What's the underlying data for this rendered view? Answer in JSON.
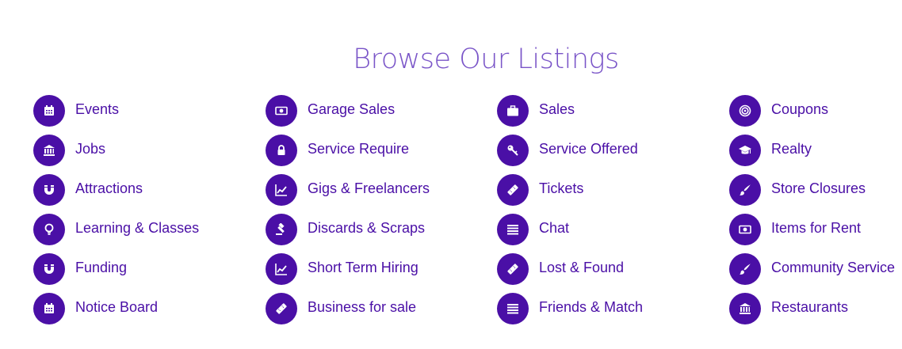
{
  "page": {
    "title": "Browse Our Listings"
  },
  "colors": {
    "title": "#7a55c8",
    "accent": "#4a0fa6",
    "icon_fg": "#ffffff",
    "background": "#ffffff"
  },
  "columns": [
    [
      {
        "label": "Events",
        "icon": "calendar-icon"
      },
      {
        "label": "Jobs",
        "icon": "bank-icon"
      },
      {
        "label": "Attractions",
        "icon": "magnet-icon"
      },
      {
        "label": "Learning & Classes",
        "icon": "lightbulb-icon"
      },
      {
        "label": "Funding",
        "icon": "magnet-icon"
      },
      {
        "label": "Notice Board",
        "icon": "calendar-icon"
      }
    ],
    [
      {
        "label": "Garage Sales",
        "icon": "money-icon"
      },
      {
        "label": "Service Require",
        "icon": "lock-icon"
      },
      {
        "label": "Gigs & Freelancers",
        "icon": "line-chart-icon"
      },
      {
        "label": "Discards & Scraps",
        "icon": "gavel-icon"
      },
      {
        "label": "Short Term Hiring",
        "icon": "line-chart-icon"
      },
      {
        "label": "Business for sale",
        "icon": "ticket-icon"
      }
    ],
    [
      {
        "label": "Sales",
        "icon": "briefcase-icon"
      },
      {
        "label": "Service Offered",
        "icon": "key-icon"
      },
      {
        "label": "Tickets",
        "icon": "ticket-icon"
      },
      {
        "label": "Chat",
        "icon": "list-icon"
      },
      {
        "label": "Lost & Found",
        "icon": "ticket-icon"
      },
      {
        "label": "Friends & Match",
        "icon": "list-icon"
      }
    ],
    [
      {
        "label": "Coupons",
        "icon": "bullseye-icon"
      },
      {
        "label": "Realty",
        "icon": "graduation-cap-icon"
      },
      {
        "label": "Store Closures",
        "icon": "paintbrush-icon"
      },
      {
        "label": "Items for Rent",
        "icon": "money-icon"
      },
      {
        "label": "Community Service",
        "icon": "paintbrush-icon"
      },
      {
        "label": "Restaurants",
        "icon": "bank-icon"
      }
    ]
  ]
}
